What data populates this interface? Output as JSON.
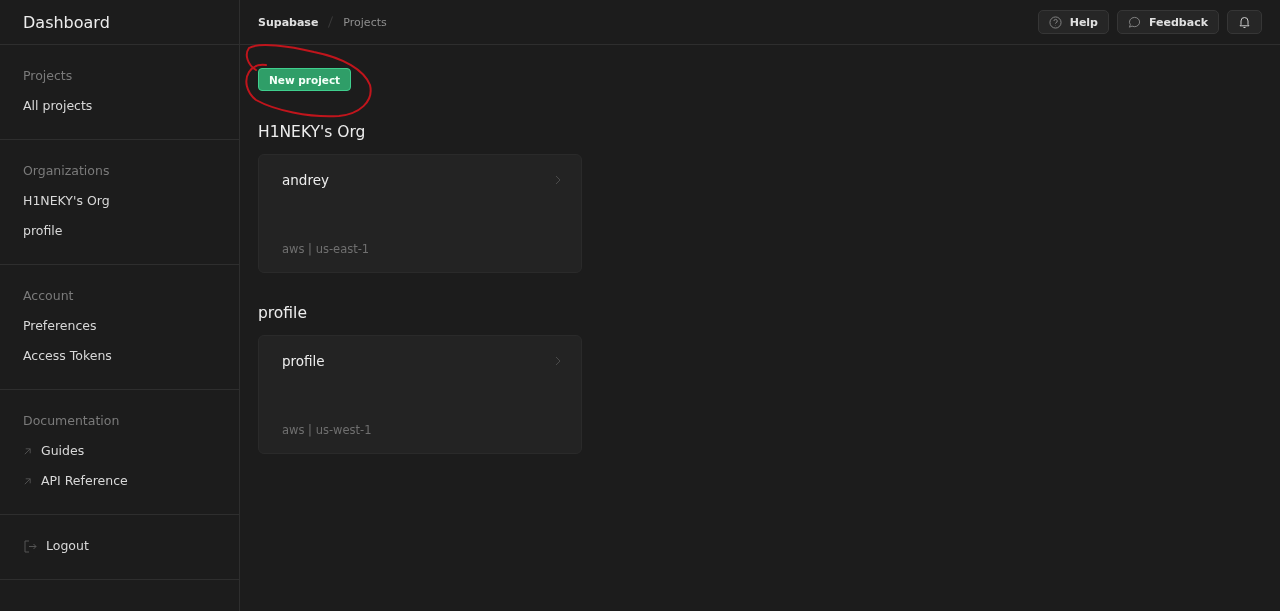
{
  "sidebar": {
    "title": "Dashboard",
    "sections": [
      {
        "heading": "Projects",
        "items": [
          {
            "label": "All projects",
            "kind": "link"
          }
        ]
      },
      {
        "heading": "Organizations",
        "items": [
          {
            "label": "H1NEKY's Org",
            "kind": "link"
          },
          {
            "label": "profile",
            "kind": "link"
          }
        ]
      },
      {
        "heading": "Account",
        "items": [
          {
            "label": "Preferences",
            "kind": "link"
          },
          {
            "label": "Access Tokens",
            "kind": "link"
          }
        ]
      },
      {
        "heading": "Documentation",
        "items": [
          {
            "label": "Guides",
            "kind": "external"
          },
          {
            "label": "API Reference",
            "kind": "external"
          }
        ]
      },
      {
        "items": [
          {
            "label": "Logout",
            "kind": "logout"
          }
        ]
      }
    ]
  },
  "header": {
    "breadcrumbs": [
      "Supabase",
      "Projects"
    ],
    "buttons": [
      {
        "label": "Help",
        "kind": "help"
      },
      {
        "label": "Feedback",
        "kind": "feedback"
      },
      {
        "kind": "notifications"
      }
    ]
  },
  "new_project_button": "New project",
  "annotation": {
    "kind": "circle"
  },
  "organizations": [
    {
      "name": "H1NEKY's Org",
      "projects": [
        {
          "name": "andrey",
          "region": "aws | us-east-1"
        }
      ]
    },
    {
      "name": "profile",
      "projects": [
        {
          "name": "profile",
          "region": "aws | us-west-1"
        }
      ]
    }
  ]
}
